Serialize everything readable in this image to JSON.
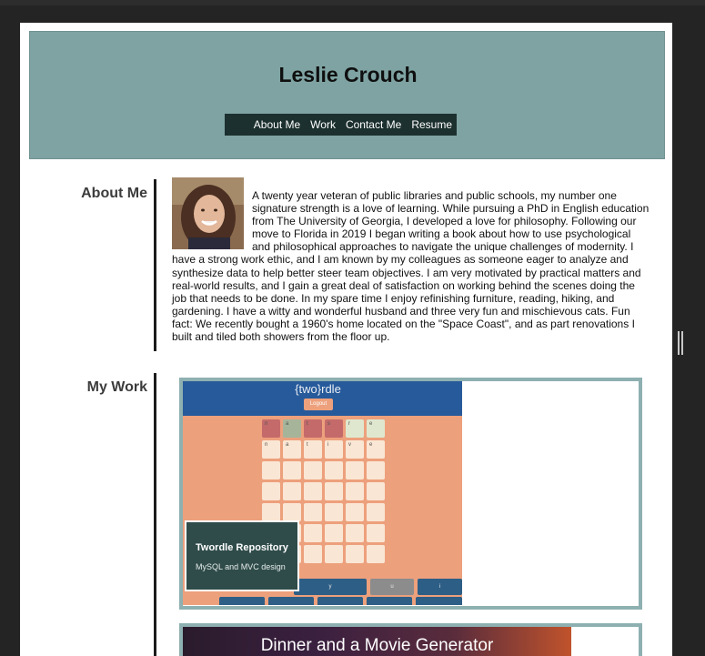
{
  "header": {
    "name": "Leslie Crouch",
    "nav": [
      "About Me",
      "Work",
      "Contact Me",
      "Resume"
    ]
  },
  "about": {
    "title": "About Me",
    "text": "A twenty year veteran of public libraries and public schools, my number one signature strength is a love of learning. While pursuing a PhD in English education from The University of Georgia, I developed a love for philosophy. Following our move to Florida in 2019 I began writing a book about how to use psychological and philosophical approaches to navigate the unique challenges of modernity. I have a strong work ethic, and I am known by my colleagues as someone eager to analyze and synthesize data to help better steer team objectives. I am very motivated by practical matters and real-world results, and I gain a great deal of satisfaction on working behind the scenes doing the job that needs to be done. In my spare time I enjoy refinishing furniture, reading, hiking, and gardening. I have a witty and wonderful husband and three very fun and mischievous cats. Fun fact: We recently bought a 1960's home located on the \"Space Coast\", and as part renovations I built and tiled both showers from the floor up."
  },
  "work": {
    "title": "My Work",
    "projects": [
      {
        "screenshot_title": "{two}rdle",
        "screenshot_button": "Logout",
        "grid_letters": [
          [
            "n",
            "a",
            "t",
            "s",
            "r",
            "e"
          ],
          [
            "n",
            "a",
            "t",
            "i",
            "v",
            "e"
          ]
        ],
        "keys": [
          "y",
          "u",
          "i"
        ],
        "caption_title": "Twordle Repository",
        "caption_sub": "MySQL and MVC design"
      },
      {
        "screenshot_title": "Dinner and a Movie Generator"
      }
    ]
  },
  "colors": {
    "header_bg": "#7fa3a3",
    "nav_bg": "#1c302f",
    "caption_bg": "#2f4c4a",
    "card_border": "#8eb0b1",
    "twordle_salmon": "#eda07c",
    "twordle_blue": "#275a9a"
  }
}
